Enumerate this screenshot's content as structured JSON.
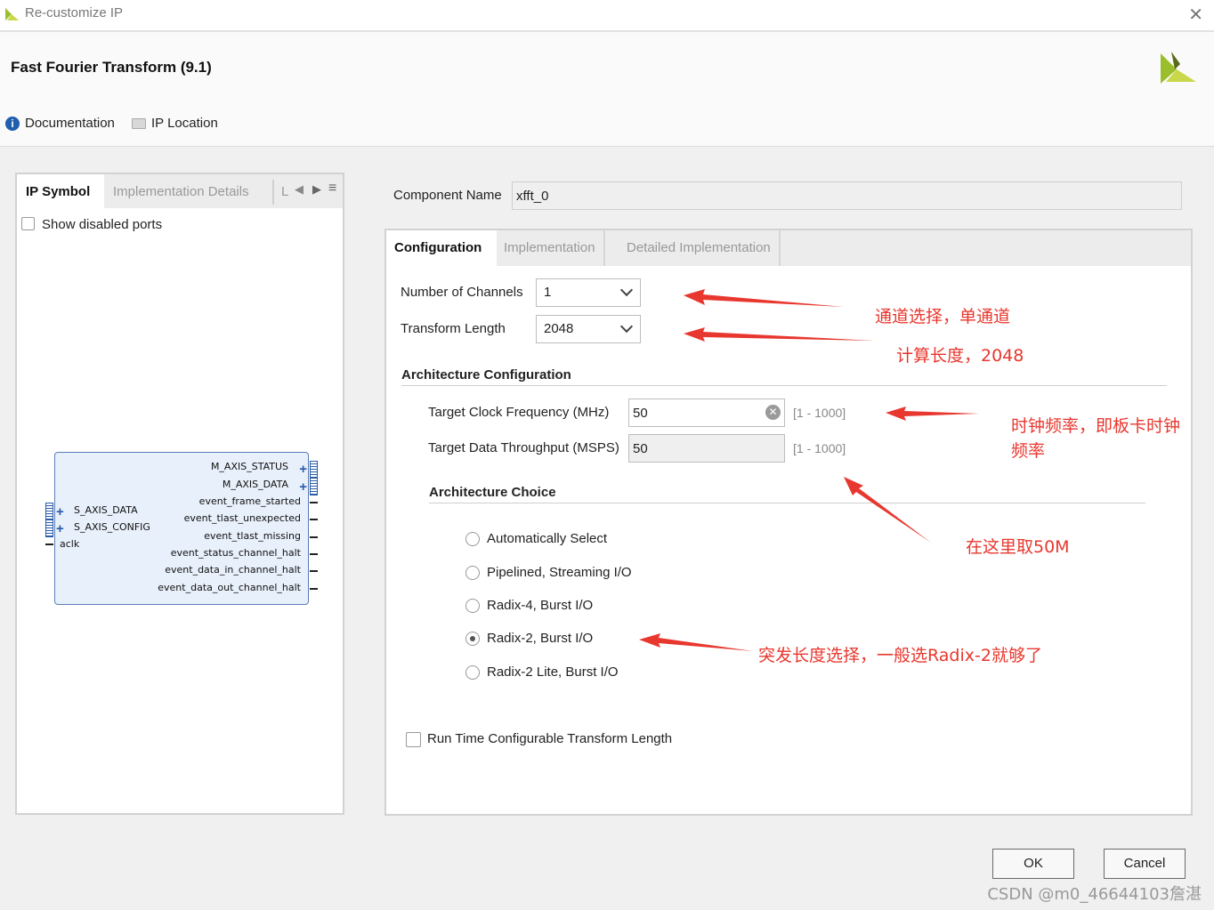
{
  "window": {
    "title": "Re-customize IP",
    "close_glyph": "✕"
  },
  "header": {
    "ip_name": "Fast Fourier Transform (9.1)",
    "links": [
      {
        "label": "Documentation",
        "icon": "info-icon"
      },
      {
        "label": "IP Location",
        "icon": "folder-icon"
      }
    ]
  },
  "left_panel": {
    "tabs": [
      "IP Symbol",
      "Implementation Details",
      "L"
    ],
    "show_disabled_ports": "Show disabled ports",
    "symbol": {
      "left_ports": [
        "S_AXIS_DATA",
        "S_AXIS_CONFIG",
        "aclk"
      ],
      "right_ports": [
        "M_AXIS_STATUS",
        "M_AXIS_DATA",
        "event_frame_started",
        "event_tlast_unexpected",
        "event_tlast_missing",
        "event_status_channel_halt",
        "event_data_in_channel_halt",
        "event_data_out_channel_halt"
      ]
    }
  },
  "component": {
    "label": "Component Name",
    "value": "xfft_0"
  },
  "right_panel": {
    "tabs": [
      "Configuration",
      "Implementation",
      "Detailed Implementation"
    ],
    "channels": {
      "label": "Number of Channels",
      "value": "1"
    },
    "transform_length": {
      "label": "Transform Length",
      "value": "2048"
    },
    "arch_config": {
      "title": "Architecture Configuration",
      "clock": {
        "label": "Target Clock Frequency (MHz)",
        "value": "50",
        "range": "[1 - 1000]"
      },
      "throughput": {
        "label": "Target Data Throughput (MSPS)",
        "value": "50",
        "range": "[1 - 1000]"
      }
    },
    "arch_choice": {
      "title": "Architecture Choice",
      "options": [
        "Automatically Select",
        "Pipelined, Streaming I/O",
        "Radix-4, Burst I/O",
        "Radix-2, Burst I/O",
        "Radix-2 Lite, Burst I/O"
      ],
      "selected": "Radix-2, Burst I/O"
    },
    "runtime_config": "Run Time Configurable Transform Length"
  },
  "buttons": {
    "ok": "OK",
    "cancel": "Cancel"
  },
  "annotations": {
    "channels": "通道选择，单通道",
    "length": "计算长度，2048",
    "clock_line1": "时钟频率，即板卡时钟",
    "clock_line2": "频率",
    "here": "在这里取50M",
    "burst": "突发长度选择，一般选Radix-2就够了"
  },
  "watermark": "CSDN @m0_46644103詹湛",
  "colors": {
    "annotation": "#e8372e",
    "logo_green": "#9bbf2c",
    "logo_dark": "#5a6b1a",
    "symbol_border": "#5a7eb5",
    "symbol_fill": "#e8f0fb"
  }
}
